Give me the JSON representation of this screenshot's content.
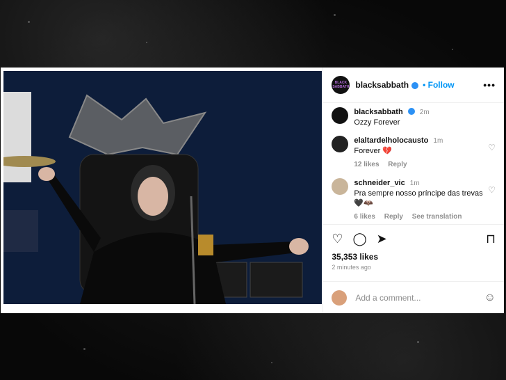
{
  "post": {
    "account": "blacksabbath",
    "follow_label": "Follow",
    "more_label": "•••",
    "logo_text": "BLACK SABBATH"
  },
  "comments": [
    {
      "user": "blacksabbath",
      "time": "2m",
      "text": "Ozzy Forever",
      "likes": "",
      "reply": "",
      "extra": ""
    },
    {
      "user": "elaltardelholocausto",
      "time": "1m",
      "text": "Forever 💔",
      "likes": "12 likes",
      "reply": "Reply",
      "extra": ""
    },
    {
      "user": "schneider_vic",
      "time": "1m",
      "text": "Pra sempre nosso príncipe das trevas 🖤🦇",
      "likes": "6 likes",
      "reply": "Reply",
      "extra": "See translation"
    }
  ],
  "stats": {
    "likes": "35,353 likes",
    "ago": "2 minutes ago"
  },
  "add_comment": {
    "placeholder": "Add a comment..."
  },
  "icons": {
    "like": "heart-icon",
    "comment": "comment-icon",
    "share": "share-icon",
    "save": "bookmark-icon",
    "emoji": "emoji-icon"
  },
  "colors": {
    "accent": "#0095f6",
    "verified": "#2c91f5",
    "muted": "#8e8e8e"
  }
}
